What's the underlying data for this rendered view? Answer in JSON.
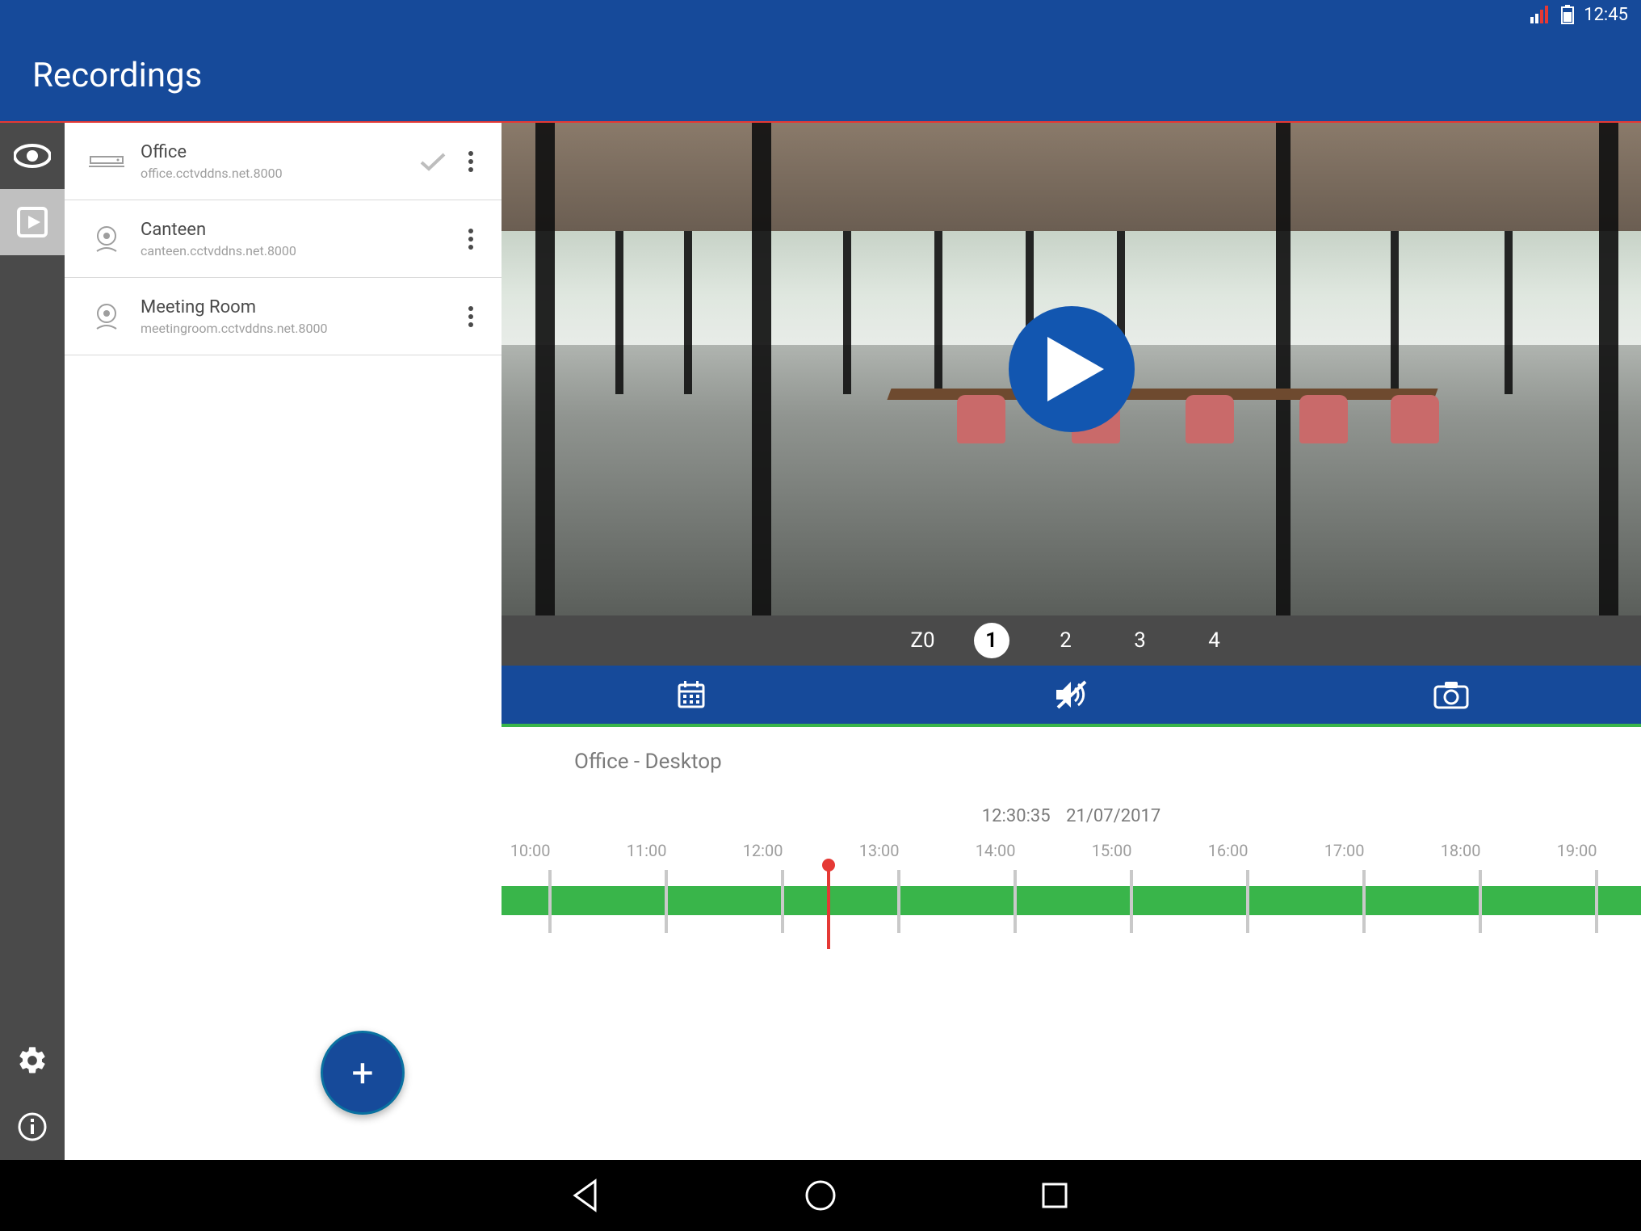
{
  "status": {
    "time": "12:45"
  },
  "header": {
    "title": "Recordings"
  },
  "navrail": {
    "items": [
      {
        "name": "live-view",
        "icon": "eye-icon"
      },
      {
        "name": "recordings",
        "icon": "play-box-icon",
        "active": true
      }
    ],
    "bottom": [
      {
        "name": "settings",
        "icon": "gear-icon"
      },
      {
        "name": "info",
        "icon": "info-icon"
      }
    ]
  },
  "cameras": {
    "items": [
      {
        "name": "Office",
        "host": "office.cctvddns.net.8000",
        "icon": "dvr-icon",
        "selected": true
      },
      {
        "name": "Canteen",
        "host": "canteen.cctvddns.net.8000",
        "icon": "webcam-icon",
        "selected": false
      },
      {
        "name": "Meeting Room",
        "host": "meetingroom.cctvddns.net.8000",
        "icon": "webcam-icon",
        "selected": false
      }
    ],
    "fab_label": "+"
  },
  "zoom": {
    "label": "Z0",
    "levels": [
      "1",
      "2",
      "3",
      "4"
    ],
    "active_index": 0
  },
  "tools": {
    "calendar": "calendar-icon",
    "mute": "volume-off-icon",
    "snapshot": "camera-icon"
  },
  "timeline": {
    "title": "Office - Desktop",
    "current_time": "12:30:35",
    "current_date": "21/07/2017",
    "ticks": [
      "10:00",
      "11:00",
      "12:00",
      "13:00",
      "14:00",
      "15:00",
      "16:00",
      "17:00",
      "18:00",
      "19:00"
    ],
    "playhead_fraction": 0.265
  }
}
